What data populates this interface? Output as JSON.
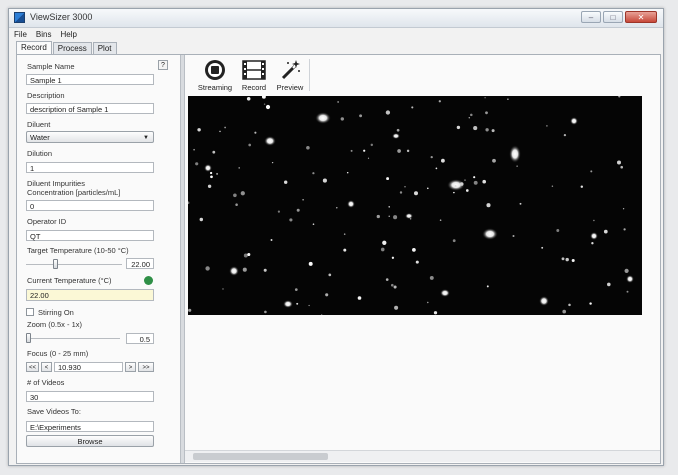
{
  "window": {
    "title": "ViewSizer 3000"
  },
  "menu": {
    "items": [
      "File",
      "Bins",
      "Help"
    ]
  },
  "tabs": [
    "Record",
    "Process",
    "Plot"
  ],
  "form": {
    "help_label": "?",
    "sample_name_label": "Sample Name",
    "sample_name_value": "Sample 1",
    "description_label": "Description",
    "description_value": "description of Sample 1",
    "diluent_label": "Diluent",
    "diluent_value": "Water",
    "dilution_label": "Dilution",
    "dilution_value": "1",
    "impurities_label_1": "Diluent Impurities",
    "impurities_label_2": "Concentration [particles/mL]",
    "impurities_value": "0",
    "operator_label": "Operator ID",
    "operator_value": "QT",
    "target_temp_label": "Target Temperature (10-50 °C)",
    "target_temp_value": "22.00",
    "target_temp_level": 0.3,
    "current_temp_label": "Current Temperature (°C)",
    "current_temp_value": "22.00",
    "status_color": "#2f8f46",
    "stirring_label": "Stirring On",
    "stirring_checked": false,
    "zoom_label": "Zoom (0.5x - 1x)",
    "zoom_value": "0.5",
    "zoom_level": 0.0,
    "focus_label": "Focus (0 - 25 mm)",
    "focus_value": "10.930",
    "focus_btn_ll": "<<",
    "focus_btn_l": "<",
    "focus_btn_r": ">",
    "focus_btn_rr": ">>",
    "videos_label": "# of Videos",
    "videos_value": "30",
    "save_label": "Save Videos To:",
    "save_value": "E:\\Experiments",
    "browse_label": "Browse"
  },
  "toolbar": {
    "streaming_label": "Streaming",
    "record_label": "Record",
    "preview_label": "Preview"
  },
  "icons": [
    "app-icon",
    "streaming-icon",
    "film-record-icon",
    "magic-wand-preview-icon",
    "dropdown-arrow-icon"
  ]
}
